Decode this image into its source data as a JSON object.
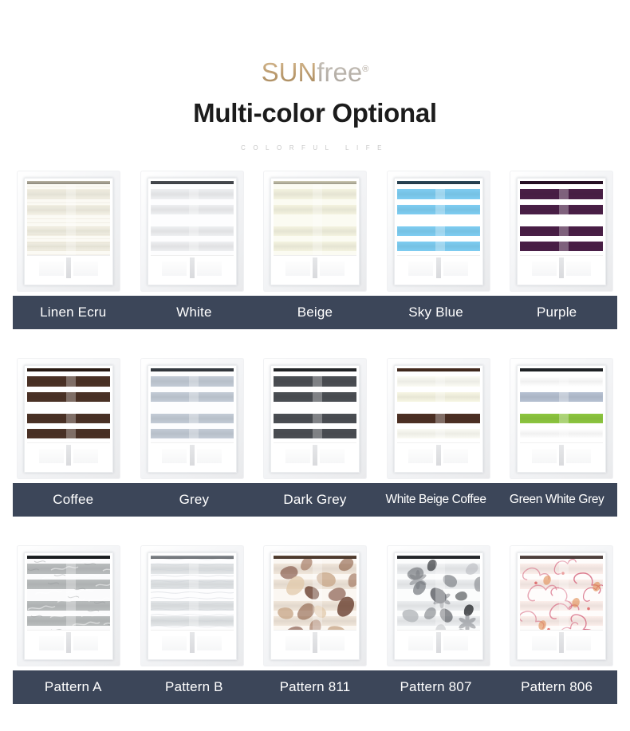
{
  "header": {
    "logo_sun": "SUN",
    "logo_free": "free",
    "logo_trademark": "®",
    "title": "Multi-color Optional",
    "subtitle": "COLORFUL LIFE"
  },
  "theme": {
    "label_bar_color": "#3c4659",
    "label_text_color": "#ffffff",
    "title_color": "#1c1c1c",
    "subtitle_color": "#c8c8c8",
    "logo_gold": "#bb9b6e",
    "logo_grey": "#b4aea6",
    "page_background": "#ffffff"
  },
  "rows": [
    {
      "row_name": "solid-colors-row-1",
      "products": [
        {
          "label": "Linen Ecru",
          "swatch_name": "linen-ecru",
          "opaque_color": "#f3f0e4",
          "sheer_color": "#fbfaf4",
          "headrail_color": "#b9b4a4",
          "texture": "linen"
        },
        {
          "label": "White",
          "swatch_name": "white",
          "opaque_color": "#eeeff1",
          "sheer_color": "#fdfdfe",
          "headrail_color": "#4d5156",
          "texture": "plain"
        },
        {
          "label": "Beige",
          "swatch_name": "beige",
          "opaque_color": "#f4f3e0",
          "sheer_color": "#fbfbf2",
          "headrail_color": "#cfcbb4",
          "texture": "plain"
        },
        {
          "label": "Sky Blue",
          "swatch_name": "sky-blue",
          "opaque_color": "#7ecdf2",
          "sheer_color": "#ffffff",
          "headrail_color": "#2e4a5c",
          "texture": "plain"
        },
        {
          "label": "Purple",
          "swatch_name": "purple",
          "opaque_color": "#4a1f47",
          "sheer_color": "#ffffff",
          "headrail_color": "#2b1229",
          "texture": "plain"
        }
      ]
    },
    {
      "row_name": "solid-colors-row-2",
      "products": [
        {
          "label": "Coffee",
          "swatch_name": "coffee",
          "opaque_color": "#4b3226",
          "sheer_color": "#ffffff",
          "headrail_color": "#2d1d15",
          "texture": "plain"
        },
        {
          "label": "Grey",
          "swatch_name": "grey",
          "opaque_color": "#c3cbd6",
          "sheer_color": "#fdfdfe",
          "headrail_color": "#3a4047",
          "texture": "plain"
        },
        {
          "label": "Dark Grey",
          "swatch_name": "dark-grey",
          "opaque_color": "#4b4f54",
          "sheer_color": "#ffffff",
          "headrail_color": "#26292c",
          "texture": "plain"
        },
        {
          "label": "White Beige Coffee",
          "swatch_name": "white-beige-coffee",
          "opaque_color": "#f6f6e8",
          "sheer_color": "#ffffff",
          "headrail_color": "#4a2f22",
          "texture": "tri-stripe",
          "stripe_colors": [
            "#fbfbf4",
            "#f7f6e4",
            "#4d3024"
          ]
        },
        {
          "label": "Green White Grey",
          "swatch_name": "green-white-grey",
          "opaque_color": "#8cc63f",
          "sheer_color": "#ffffff",
          "headrail_color": "#23272b",
          "texture": "tri-stripe",
          "stripe_colors": [
            "#ffffff",
            "#b6c1d2",
            "#8cc63f"
          ]
        }
      ]
    },
    {
      "row_name": "patterned-row-3",
      "products": [
        {
          "label": "Pattern A",
          "swatch_name": "pattern-a",
          "opaque_color": "#b9bcbd",
          "sheer_color": "#fbfbfc",
          "headrail_color": "#1f2326",
          "texture": "marble-grey"
        },
        {
          "label": "Pattern B",
          "swatch_name": "pattern-b",
          "opaque_color": "#e3e6e8",
          "sheer_color": "#fdfdfe",
          "headrail_color": "#8b9095",
          "texture": "wave-light"
        },
        {
          "label": "Pattern 811",
          "swatch_name": "pattern-811",
          "opaque_color": "#f0e6da",
          "sheer_color": "#fbf7f2",
          "headrail_color": "#5b4436",
          "texture": "leaves-brown"
        },
        {
          "label": "Pattern 807",
          "swatch_name": "pattern-807",
          "opaque_color": "#eceef0",
          "sheer_color": "#fbfcfc",
          "headrail_color": "#2a2d31",
          "texture": "floral-grey"
        },
        {
          "label": "Pattern 806",
          "swatch_name": "pattern-806",
          "opaque_color": "#fbeeea",
          "sheer_color": "#fefcfb",
          "headrail_color": "#5a4a46",
          "texture": "floral-pink"
        }
      ]
    }
  ]
}
